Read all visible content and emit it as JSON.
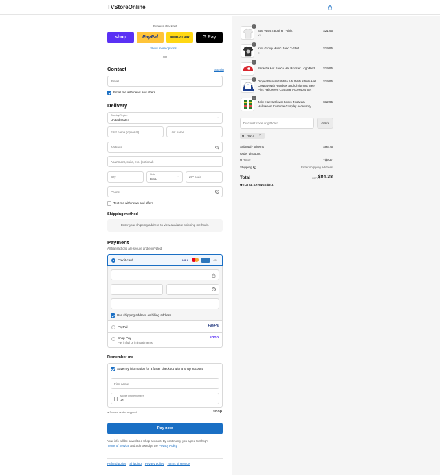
{
  "header": {
    "brand": "TVStoreOnline",
    "cart_icon": "bag-icon"
  },
  "express": {
    "label": "Express checkout",
    "buttons": [
      "shop",
      "PayPal",
      "amazon pay",
      "G Pay"
    ],
    "show_more": "Show more options",
    "or": "OR"
  },
  "contact": {
    "title": "Contact",
    "sign_in": "Sign in",
    "email_placeholder": "Email",
    "email_news": "Email me with news and offers"
  },
  "delivery": {
    "title": "Delivery",
    "country_label": "Country/Region",
    "country_value": "United States",
    "first_name": "First name (optional)",
    "last_name": "Last name",
    "address": "Address",
    "apartment": "Apartment, suite, etc. (optional)",
    "city": "City",
    "state_label": "State",
    "state_value": "Iowa",
    "zip": "ZIP code",
    "phone": "Phone",
    "text_news": "Text me with news and offers"
  },
  "shipping": {
    "title": "Shipping method",
    "message": "Enter your shipping address to view available shipping methods."
  },
  "payment": {
    "title": "Payment",
    "subtitle": "All transactions are secure and encrypted.",
    "credit_card": "Credit card",
    "more_cards": "+5",
    "billing_same": "Use shipping address as billing address",
    "paypal": "PayPal",
    "shop_pay": "Shop Pay",
    "shop_pay_sub": "Pay in full or in installments"
  },
  "remember": {
    "title": "Remember me",
    "save_info": "Save my information for a faster checkout with a Shop account",
    "first_name": "First name",
    "mobile_label": "Mobile phone number",
    "mobile_value": "+1",
    "secure": "Secure and encrypted",
    "shop_logo": "shop"
  },
  "pay_now": "Pay now",
  "legal": {
    "line1": "Your info will be saved to a Shop account. By continuing, you agree to Shop's",
    "tos": "Terms of Service",
    "and_ack": "and acknowledge the",
    "privacy": "Privacy Policy"
  },
  "footer_links": [
    "Refund policy",
    "Shipping",
    "Privacy policy",
    "Terms of service"
  ],
  "cart": {
    "items": [
      {
        "name": "Star Wars Tatooine T-shirt",
        "variant": "XL",
        "price": "$21.95",
        "qty": "1"
      },
      {
        "name": "Kiss Group Music Band T-Shirt",
        "variant": "S",
        "price": "$19.95",
        "qty": "1"
      },
      {
        "name": "Sriracha Hot Sauce Hat Rooster Logo Red",
        "variant": "",
        "price": "$19.95",
        "qty": "1"
      },
      {
        "name": "Dipper Blue and White Adult Adjustable Hat Cosplay with Rainbow and Christmas Tree Pins Halloween Costume Accessory Set",
        "variant": "",
        "price": "$19.95",
        "qty": "1"
      },
      {
        "name": "Joke Ha Ha Clown Socks Footwear Halloween Costume Cosplay Accessory",
        "variant": "",
        "price": "$12.95",
        "qty": "1"
      }
    ],
    "discount_placeholder": "Discount code or gift card",
    "apply": "Apply",
    "code_tag": "HW10",
    "subtotal_label": "Subtotal · 5 items",
    "subtotal_value": "$93.75",
    "order_discount": "Order discount",
    "discount_code": "HW10",
    "discount_value": "−$9.37",
    "shipping_label": "Shipping",
    "shipping_value": "Enter shipping address",
    "total_label": "Total",
    "currency": "USD",
    "total_value": "$84.38",
    "savings_label": "TOTAL SAVINGS",
    "savings_value": "$9.37"
  },
  "colors": {
    "accent": "#1a6fc4",
    "shop": "#5a31f4",
    "paypal": "#ffc439",
    "amazon": "#ffd814",
    "gpay": "#000000"
  }
}
